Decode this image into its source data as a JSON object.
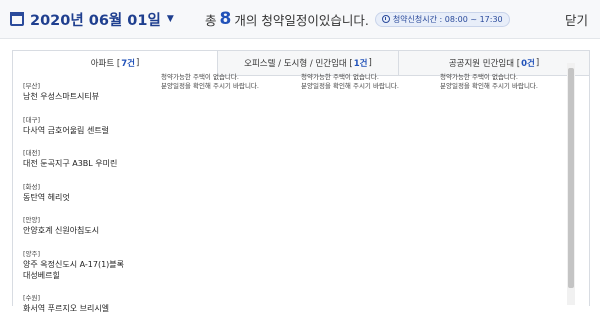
{
  "header": {
    "date": "2020년 06월 01일",
    "summary_prefix": "총",
    "count": "8",
    "summary_suffix": "개의 청약일정이있습니다.",
    "hours_label": "청약신청시간 : 08:00 ~ 17:30",
    "close_label": "닫기"
  },
  "tabs": [
    {
      "label": "아파트 [",
      "count": "7건",
      "close": "]"
    },
    {
      "label": "오피스텔 / 도시형 / 민간임대 [",
      "count": "1건",
      "close": "]"
    },
    {
      "label": "공공지원 민간임대 [",
      "count": "0건",
      "close": "]"
    }
  ],
  "messages": [
    {
      "line1": "청약가능한 주택이 없습니다.",
      "line2": "분양일정을 확인해 주시기 바랍니다."
    },
    {
      "line1": "청약가능한 주택이 없습니다.",
      "line2": "분양일정을 확인해 주시기 바랍니다."
    },
    {
      "line1": "청약가능한 주택이 없습니다.",
      "line2": "분양일정을 확인해 주시기 바랍니다."
    }
  ],
  "listings": [
    {
      "region": "[부산]",
      "name": "남천 우성스마트시티뷰"
    },
    {
      "region": "[대구]",
      "name": "다사역 금호어울림 센트럴"
    },
    {
      "region": "[대전]",
      "name": "대전 둔곡지구 A3BL 우미린"
    },
    {
      "region": "[화성]",
      "name": "동탄역 헤리엇"
    },
    {
      "region": "[안양]",
      "name": "안양호계 신원아침도시"
    },
    {
      "region": "[양주]",
      "name": "양주 옥정신도시 A-17(1)블록",
      "name2": "대성베르힐"
    },
    {
      "region": "[수원]",
      "name": "화서역 푸르지오 브리시엘"
    }
  ],
  "colors": {
    "brand": "#1f3f8f",
    "accent": "#2152b9"
  }
}
